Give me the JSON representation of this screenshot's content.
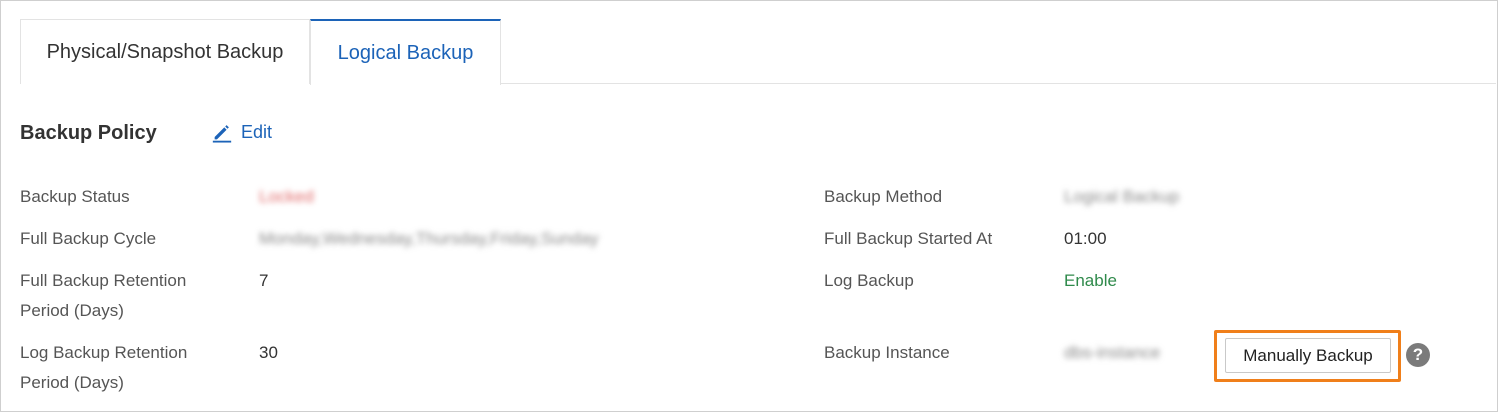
{
  "tabs": [
    {
      "label": "Physical/Snapshot Backup",
      "active": false
    },
    {
      "label": "Logical Backup",
      "active": true
    }
  ],
  "section": {
    "title": "Backup Policy",
    "edit_label": "Edit"
  },
  "left_fields": {
    "backup_status": {
      "label": "Backup Status",
      "value": "Locked"
    },
    "full_backup_cycle": {
      "label": "Full Backup Cycle",
      "value": "Monday,Wednesday,Thursday,Friday,Sunday"
    },
    "full_backup_retention": {
      "label_line1": "Full Backup Retention",
      "label_line2": "Period (Days)",
      "value": "7"
    },
    "log_backup_retention": {
      "label_line1": "Log Backup Retention",
      "label_line2": "Period (Days)",
      "value": "30"
    }
  },
  "right_fields": {
    "backup_method": {
      "label": "Backup Method",
      "value": "Logical Backup"
    },
    "full_backup_started_at": {
      "label": "Full Backup Started At",
      "value": "01:00"
    },
    "log_backup": {
      "label": "Log Backup",
      "value": "Enable"
    },
    "backup_instance": {
      "label": "Backup Instance",
      "value": "dbs-instance"
    }
  },
  "actions": {
    "manual_backup_label": "Manually Backup",
    "help_glyph": "?"
  },
  "colors": {
    "accent": "#1c63b8",
    "enable": "#2f8a4b",
    "highlight": "#f07f1a"
  },
  "icons": {
    "edit": "pencil-icon",
    "help": "question-circle-icon"
  }
}
